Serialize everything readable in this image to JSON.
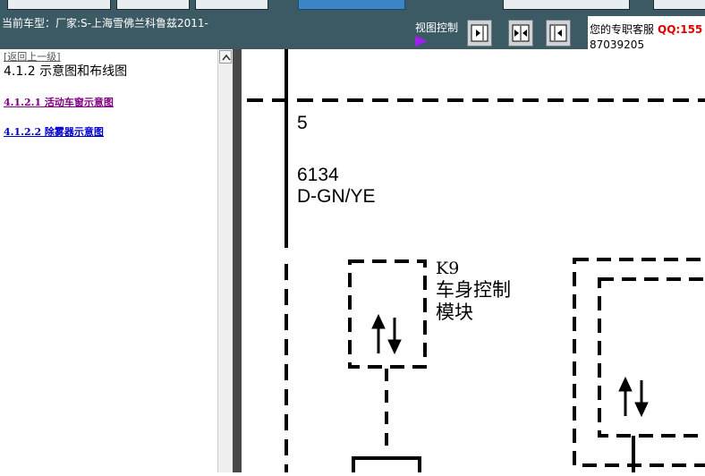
{
  "header": {
    "current_car": "当前车型：厂家:S-上海雪佛兰科鲁兹2011-",
    "view_control_label": "视图控制",
    "service_label": "您的专职客服",
    "service_qq": "QQ:155",
    "service_phone": "87039205"
  },
  "sidebar": {
    "back_link": "[返回上一级]",
    "section_title": "4.1.2 示意图和布线图",
    "items": [
      {
        "label": "4.1.2.1 活动车窗示意图",
        "color": "#800080"
      },
      {
        "label": "4.1.2.2 除雾器示意图",
        "color": "#0000cc"
      }
    ]
  },
  "diagram": {
    "pin_number": "5",
    "circuit_number": "6134",
    "wire_color": "D-GN/YE",
    "module_id": "K9",
    "module_name_line1": "车身控制",
    "module_name_line2": "模块"
  },
  "colors": {
    "topbar": "#3c5a64",
    "splitter": "#4a4a4a",
    "qq": "#e00000",
    "play_arrow": "#a020f0"
  },
  "icons": [
    "play-arrow-icon",
    "collapse-left-icon",
    "split-view-icon",
    "collapse-right-icon",
    "scroll-up-icon"
  ]
}
